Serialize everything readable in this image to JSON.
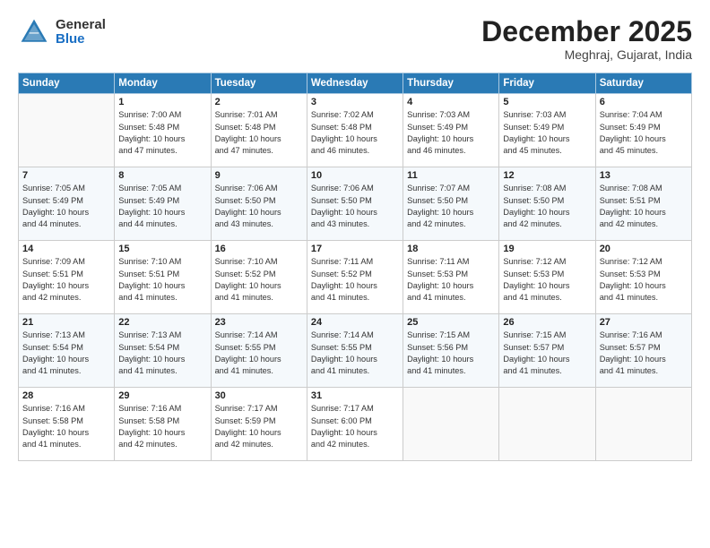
{
  "logo": {
    "general": "General",
    "blue": "Blue"
  },
  "header": {
    "month": "December 2025",
    "location": "Meghraj, Gujarat, India"
  },
  "days_of_week": [
    "Sunday",
    "Monday",
    "Tuesday",
    "Wednesday",
    "Thursday",
    "Friday",
    "Saturday"
  ],
  "weeks": [
    [
      {
        "day": "",
        "info": ""
      },
      {
        "day": "1",
        "info": "Sunrise: 7:00 AM\nSunset: 5:48 PM\nDaylight: 10 hours\nand 47 minutes."
      },
      {
        "day": "2",
        "info": "Sunrise: 7:01 AM\nSunset: 5:48 PM\nDaylight: 10 hours\nand 47 minutes."
      },
      {
        "day": "3",
        "info": "Sunrise: 7:02 AM\nSunset: 5:48 PM\nDaylight: 10 hours\nand 46 minutes."
      },
      {
        "day": "4",
        "info": "Sunrise: 7:03 AM\nSunset: 5:49 PM\nDaylight: 10 hours\nand 46 minutes."
      },
      {
        "day": "5",
        "info": "Sunrise: 7:03 AM\nSunset: 5:49 PM\nDaylight: 10 hours\nand 45 minutes."
      },
      {
        "day": "6",
        "info": "Sunrise: 7:04 AM\nSunset: 5:49 PM\nDaylight: 10 hours\nand 45 minutes."
      }
    ],
    [
      {
        "day": "7",
        "info": "Sunrise: 7:05 AM\nSunset: 5:49 PM\nDaylight: 10 hours\nand 44 minutes."
      },
      {
        "day": "8",
        "info": "Sunrise: 7:05 AM\nSunset: 5:49 PM\nDaylight: 10 hours\nand 44 minutes."
      },
      {
        "day": "9",
        "info": "Sunrise: 7:06 AM\nSunset: 5:50 PM\nDaylight: 10 hours\nand 43 minutes."
      },
      {
        "day": "10",
        "info": "Sunrise: 7:06 AM\nSunset: 5:50 PM\nDaylight: 10 hours\nand 43 minutes."
      },
      {
        "day": "11",
        "info": "Sunrise: 7:07 AM\nSunset: 5:50 PM\nDaylight: 10 hours\nand 42 minutes."
      },
      {
        "day": "12",
        "info": "Sunrise: 7:08 AM\nSunset: 5:50 PM\nDaylight: 10 hours\nand 42 minutes."
      },
      {
        "day": "13",
        "info": "Sunrise: 7:08 AM\nSunset: 5:51 PM\nDaylight: 10 hours\nand 42 minutes."
      }
    ],
    [
      {
        "day": "14",
        "info": "Sunrise: 7:09 AM\nSunset: 5:51 PM\nDaylight: 10 hours\nand 42 minutes."
      },
      {
        "day": "15",
        "info": "Sunrise: 7:10 AM\nSunset: 5:51 PM\nDaylight: 10 hours\nand 41 minutes."
      },
      {
        "day": "16",
        "info": "Sunrise: 7:10 AM\nSunset: 5:52 PM\nDaylight: 10 hours\nand 41 minutes."
      },
      {
        "day": "17",
        "info": "Sunrise: 7:11 AM\nSunset: 5:52 PM\nDaylight: 10 hours\nand 41 minutes."
      },
      {
        "day": "18",
        "info": "Sunrise: 7:11 AM\nSunset: 5:53 PM\nDaylight: 10 hours\nand 41 minutes."
      },
      {
        "day": "19",
        "info": "Sunrise: 7:12 AM\nSunset: 5:53 PM\nDaylight: 10 hours\nand 41 minutes."
      },
      {
        "day": "20",
        "info": "Sunrise: 7:12 AM\nSunset: 5:53 PM\nDaylight: 10 hours\nand 41 minutes."
      }
    ],
    [
      {
        "day": "21",
        "info": "Sunrise: 7:13 AM\nSunset: 5:54 PM\nDaylight: 10 hours\nand 41 minutes."
      },
      {
        "day": "22",
        "info": "Sunrise: 7:13 AM\nSunset: 5:54 PM\nDaylight: 10 hours\nand 41 minutes."
      },
      {
        "day": "23",
        "info": "Sunrise: 7:14 AM\nSunset: 5:55 PM\nDaylight: 10 hours\nand 41 minutes."
      },
      {
        "day": "24",
        "info": "Sunrise: 7:14 AM\nSunset: 5:55 PM\nDaylight: 10 hours\nand 41 minutes."
      },
      {
        "day": "25",
        "info": "Sunrise: 7:15 AM\nSunset: 5:56 PM\nDaylight: 10 hours\nand 41 minutes."
      },
      {
        "day": "26",
        "info": "Sunrise: 7:15 AM\nSunset: 5:57 PM\nDaylight: 10 hours\nand 41 minutes."
      },
      {
        "day": "27",
        "info": "Sunrise: 7:16 AM\nSunset: 5:57 PM\nDaylight: 10 hours\nand 41 minutes."
      }
    ],
    [
      {
        "day": "28",
        "info": "Sunrise: 7:16 AM\nSunset: 5:58 PM\nDaylight: 10 hours\nand 41 minutes."
      },
      {
        "day": "29",
        "info": "Sunrise: 7:16 AM\nSunset: 5:58 PM\nDaylight: 10 hours\nand 42 minutes."
      },
      {
        "day": "30",
        "info": "Sunrise: 7:17 AM\nSunset: 5:59 PM\nDaylight: 10 hours\nand 42 minutes."
      },
      {
        "day": "31",
        "info": "Sunrise: 7:17 AM\nSunset: 6:00 PM\nDaylight: 10 hours\nand 42 minutes."
      },
      {
        "day": "",
        "info": ""
      },
      {
        "day": "",
        "info": ""
      },
      {
        "day": "",
        "info": ""
      }
    ]
  ]
}
